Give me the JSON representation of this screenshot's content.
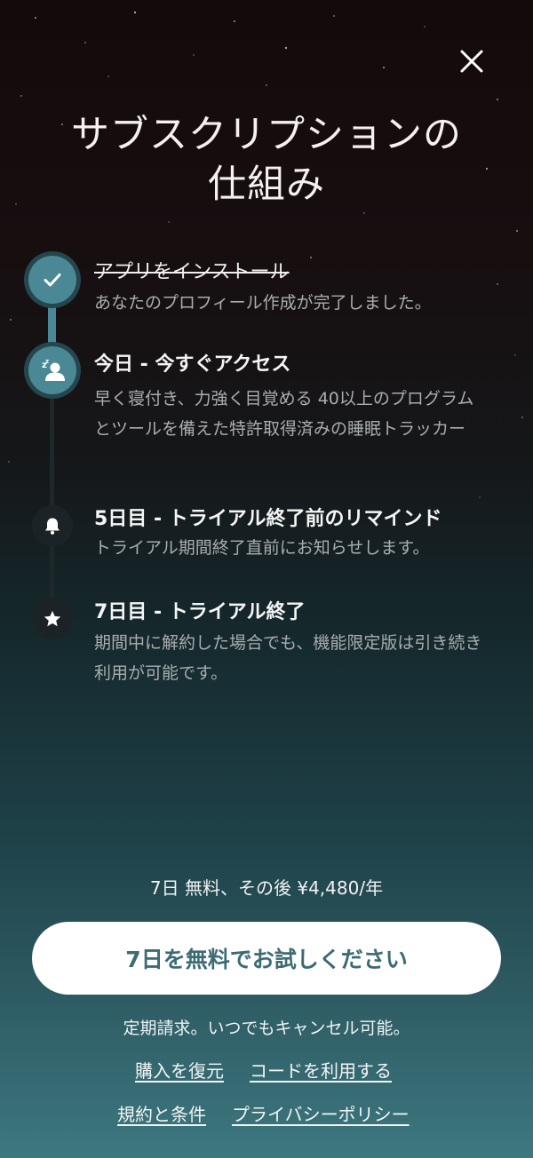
{
  "close": {
    "icon": "close-icon"
  },
  "header": {
    "title_line1": "サブスクリプションの",
    "title_line2": "仕組み"
  },
  "steps": [
    {
      "icon": "checkmark-icon",
      "title": "アプリをインストール",
      "desc": "あなたのプロフィール作成が完了しました。",
      "completed": true
    },
    {
      "icon": "sleeping-person-icon",
      "title": "今日 - 今すぐアクセス",
      "desc": "早く寝付き、力強く目覚める 40以上のプログラムとツールを備えた特許取得済みの睡眠トラッカー",
      "active": true
    },
    {
      "icon": "bell-icon",
      "title": "5日目 - トライアル終了前のリマインド",
      "desc": "トライアル期間終了直前にお知らせします。"
    },
    {
      "icon": "star-icon",
      "title": "7日目 - トライアル終了",
      "desc": "期間中に解約した場合でも、機能限定版は引き続き利用が可能です。"
    }
  ],
  "pricing": {
    "summary": "7日 無料、その後 ¥4,480/年"
  },
  "cta": {
    "label": "7日を無料でお試しください"
  },
  "footer": {
    "billing_note": "定期請求。いつでもキャンセル可能。",
    "links": {
      "restore": "購入を復元",
      "redeem": "コードを利用する",
      "terms": "規約と条件",
      "privacy": "プライバシーポリシー"
    }
  },
  "colors": {
    "accent": "#4b8895",
    "cta_text": "#3c6b73",
    "background_top": "#140a0c",
    "background_bottom": "#3d7880"
  }
}
